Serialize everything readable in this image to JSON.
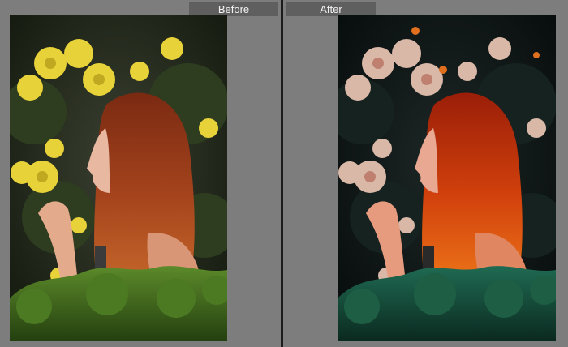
{
  "panels": {
    "before": {
      "label": "Before"
    },
    "after": {
      "label": "After"
    }
  },
  "colors": {
    "background": "#7f7f7f",
    "tab": "#5f5f5f",
    "tab_text": "#f2f2f2",
    "divider": "#1c1c1c"
  }
}
